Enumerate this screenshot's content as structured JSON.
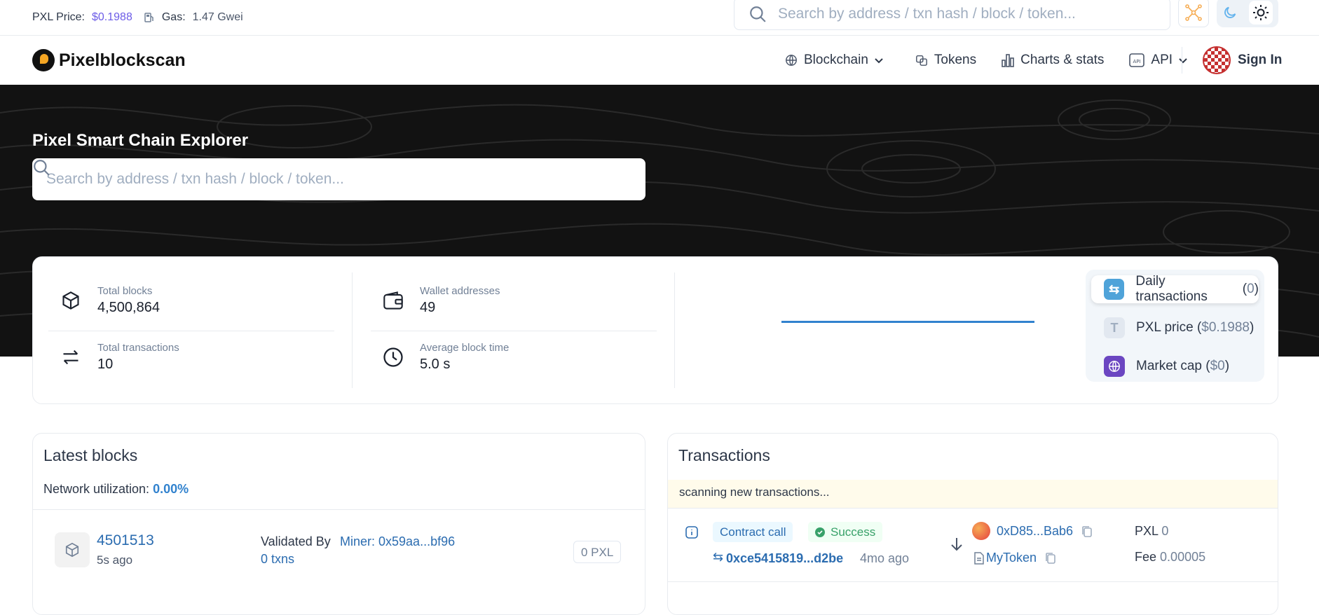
{
  "topbar": {
    "price_label": "PXL Price:",
    "price_value": "$0.1988",
    "gas_label": "Gas:",
    "gas_value": "1.47 Gwei",
    "search_placeholder": "Search by address / txn hash / block / token..."
  },
  "nav": {
    "brand": "Pixelblockscan",
    "items": [
      {
        "label": "Blockchain",
        "icon": "globe-icon",
        "has_dropdown": true
      },
      {
        "label": "Tokens",
        "icon": "coins-icon",
        "has_dropdown": false
      },
      {
        "label": "Charts & stats",
        "icon": "bar-chart-icon",
        "has_dropdown": false
      },
      {
        "label": "API",
        "icon": "api-icon",
        "has_dropdown": true
      }
    ],
    "signin": "Sign In"
  },
  "hero": {
    "title": "Pixel Smart Chain Explorer",
    "search_placeholder": "Search by address / txn hash / block / token..."
  },
  "stats": {
    "total_blocks": {
      "label": "Total blocks",
      "value": "4,500,864"
    },
    "total_transactions": {
      "label": "Total transactions",
      "value": "10"
    },
    "wallet_addresses": {
      "label": "Wallet addresses",
      "value": "49"
    },
    "avg_block_time": {
      "label": "Average block time",
      "value": "5.0 s"
    }
  },
  "chart_switch": [
    {
      "label": "Daily transactions",
      "value": "0",
      "active": true
    },
    {
      "label": "PXL price",
      "value": "$0.1988",
      "active": false
    },
    {
      "label": "Market cap",
      "value": "$0",
      "active": false
    }
  ],
  "latest_blocks": {
    "title": "Latest blocks",
    "utilization_label": "Network utilization:",
    "utilization_value": "0.00%",
    "block": {
      "number": "4501513",
      "age": "5s ago",
      "validated_by_label": "Validated By",
      "miner": "Miner: 0x59aa...bf96",
      "txns": "0 txns",
      "reward": "0 PXL"
    }
  },
  "transactions": {
    "title": "Transactions",
    "scanning": "scanning new transactions...",
    "tx": {
      "type": "Contract call",
      "status": "Success",
      "hash": "0xce5415819...d2be",
      "age": "4mo ago",
      "from": "0xD85...Bab6",
      "to": "MyToken",
      "value_label": "PXL",
      "value": "0",
      "fee_label": "Fee",
      "fee": "0.00005"
    }
  },
  "colors": {
    "accent": "#3182ce",
    "link": "#2b6cb0",
    "price": "#6c5ce7",
    "success": "#38a169"
  }
}
